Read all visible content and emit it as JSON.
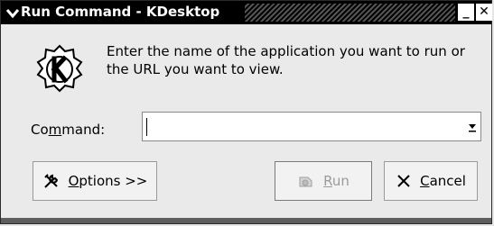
{
  "window": {
    "title": "Run Command - KDesktop"
  },
  "titlebar": {
    "menu_icon": "chevron-down-icon",
    "minimize_glyph": "_",
    "close_glyph": "✕"
  },
  "logo": {
    "icon": "kde-logo-icon"
  },
  "message": {
    "text": "Enter the name of the application you want to run or the URL you want to view."
  },
  "command": {
    "label_pre": "Co",
    "label_mnemonic": "m",
    "label_post": "mand:",
    "value": ""
  },
  "buttons": {
    "options": {
      "mnemonic": "O",
      "rest": "ptions >>",
      "icon": "tools-icon"
    },
    "run": {
      "mnemonic": "R",
      "rest": "un",
      "icon": "run-icon",
      "enabled": false
    },
    "cancel": {
      "mnemonic": "C",
      "rest": "ancel",
      "icon": "cancel-icon"
    }
  }
}
